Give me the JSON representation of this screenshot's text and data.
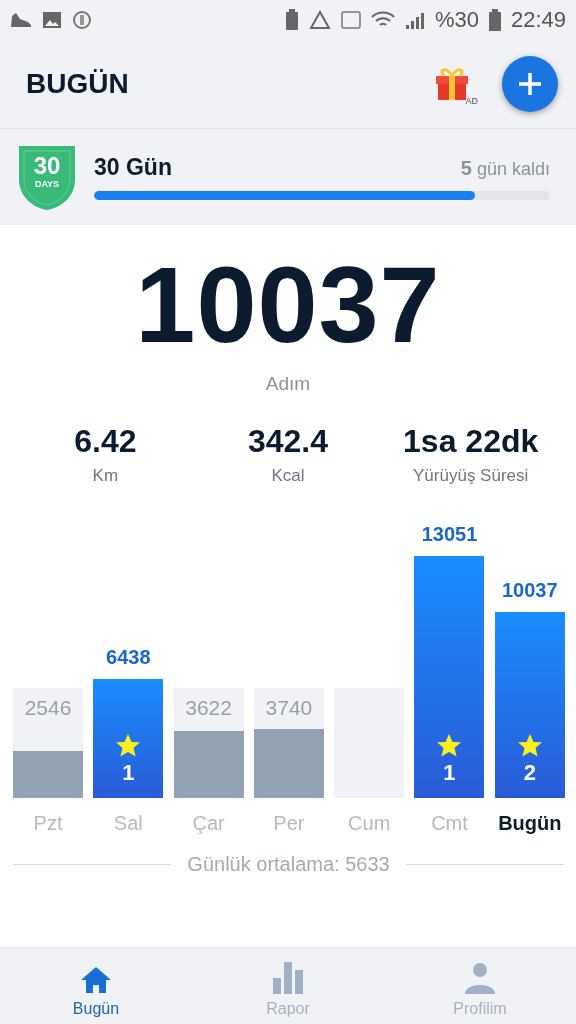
{
  "status_bar": {
    "battery_text": "%30",
    "time": "22:49"
  },
  "header": {
    "title": "BUGÜN",
    "ad_badge": "AD"
  },
  "challenge": {
    "badge_number": "30",
    "badge_caption": "DAYS",
    "title": "30 Gün",
    "remaining": "**5** gün kaldı",
    "level": 0.835
  },
  "summary": {
    "steps": "10037",
    "steps_label": "Adım",
    "stats": [
      {
        "value": "6.42",
        "label": "Km"
      },
      {
        "value": "342.4",
        "label": "Kcal"
      },
      {
        "value": "1sa 22dk",
        "label": "Yürüyüş Süresi"
      }
    ]
  },
  "week": {
    "days": [
      {
        "label": "Pzt",
        "value": "2546",
        "goal_met": false,
        "selected": false
      },
      {
        "label": "Sal",
        "value": "6438",
        "goal_met": true,
        "badge": "1",
        "selected": false
      },
      {
        "label": "Çar",
        "value": "3622",
        "goal_met": false,
        "selected": false
      },
      {
        "label": "Per",
        "value": "3740",
        "goal_met": false,
        "selected": false
      },
      {
        "label": "Cum",
        "goal_met": false,
        "selected": false
      },
      {
        "label": "Cmt",
        "value": "13051",
        "goal_met": true,
        "badge": "1",
        "selected": false
      },
      {
        "label": "Bugün",
        "value": "10037",
        "goal_met": true,
        "badge": "2",
        "selected": true
      }
    ],
    "average": "Günlük ortalama: 5633"
  },
  "nav": [
    {
      "label": "Bugün",
      "selected": true
    },
    {
      "label": "Rapor",
      "selected": false
    },
    {
      "label": "Profilim",
      "selected": false
    }
  ]
}
